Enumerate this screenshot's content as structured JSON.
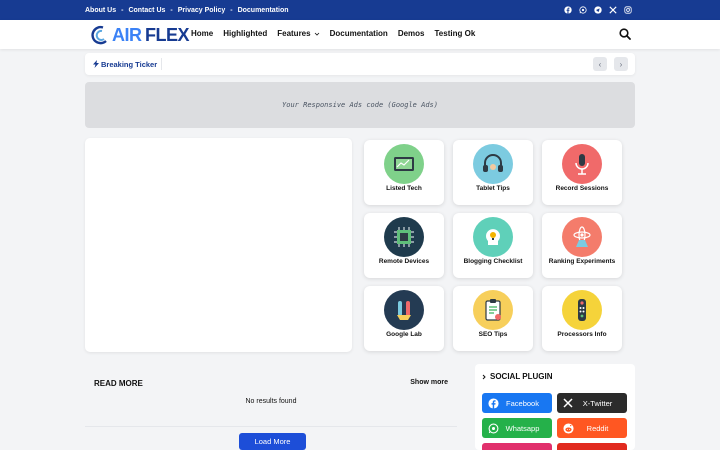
{
  "top_links": [
    "About Us",
    "Contact Us",
    "Privacy Policy",
    "Documentation"
  ],
  "top_social_icons": [
    "facebook-icon",
    "whatsapp-icon",
    "telegram-icon",
    "x-twitter-icon",
    "instagram-icon"
  ],
  "logo": {
    "part1": "AIR",
    "part2": "FLEX"
  },
  "nav": [
    {
      "label": "Home"
    },
    {
      "label": "Highlighted"
    },
    {
      "label": "Features",
      "has_dropdown": true
    },
    {
      "label": "Documentation"
    },
    {
      "label": "Demos"
    },
    {
      "label": "Testing Ok"
    }
  ],
  "ticker": {
    "label": "Breaking Ticker"
  },
  "ad": {
    "text": "Your Responsive Ads code (Google Ads)"
  },
  "categories": [
    {
      "label": "Listed Tech",
      "color": "#7fd18a",
      "icon": "tablet-chart-icon"
    },
    {
      "label": "Tablet Tips",
      "color": "#7ccbe0",
      "icon": "headset-icon"
    },
    {
      "label": "Record Sessions",
      "color": "#f06a6a",
      "icon": "microphone-icon"
    },
    {
      "label": "Remote Devices",
      "color": "#1f3b4d",
      "icon": "cpu-chip-icon"
    },
    {
      "label": "Blogging Checklist",
      "color": "#5fd0b9",
      "icon": "idea-head-icon"
    },
    {
      "label": "Ranking Experiments",
      "color": "#f47c6b",
      "icon": "atom-flask-icon"
    },
    {
      "label": "Google Lab",
      "color": "#243b53",
      "icon": "lab-tubes-icon"
    },
    {
      "label": "SEO Tips",
      "color": "#f7cf5b",
      "icon": "clipboard-icon"
    },
    {
      "label": "Processors Info",
      "color": "#f5d33a",
      "icon": "remote-control-icon"
    }
  ],
  "read_more": {
    "title": "READ MORE",
    "show_more": "Show more",
    "empty": "No results found",
    "load_more": "Load More"
  },
  "social_plugin": {
    "title": "SOCIAL PLUGIN",
    "buttons": [
      {
        "label": "Facebook",
        "color": "#1877f2",
        "icon": "facebook-icon"
      },
      {
        "label": "X-Twitter",
        "color": "#2b2b2b",
        "icon": "x-twitter-icon"
      },
      {
        "label": "Whatsapp",
        "color": "#25b14a",
        "icon": "whatsapp-icon"
      },
      {
        "label": "Reddit",
        "color": "#ff5722",
        "icon": "reddit-icon"
      }
    ]
  },
  "colors": {
    "brand": "#173b92",
    "accent": "#1d4ed8"
  }
}
